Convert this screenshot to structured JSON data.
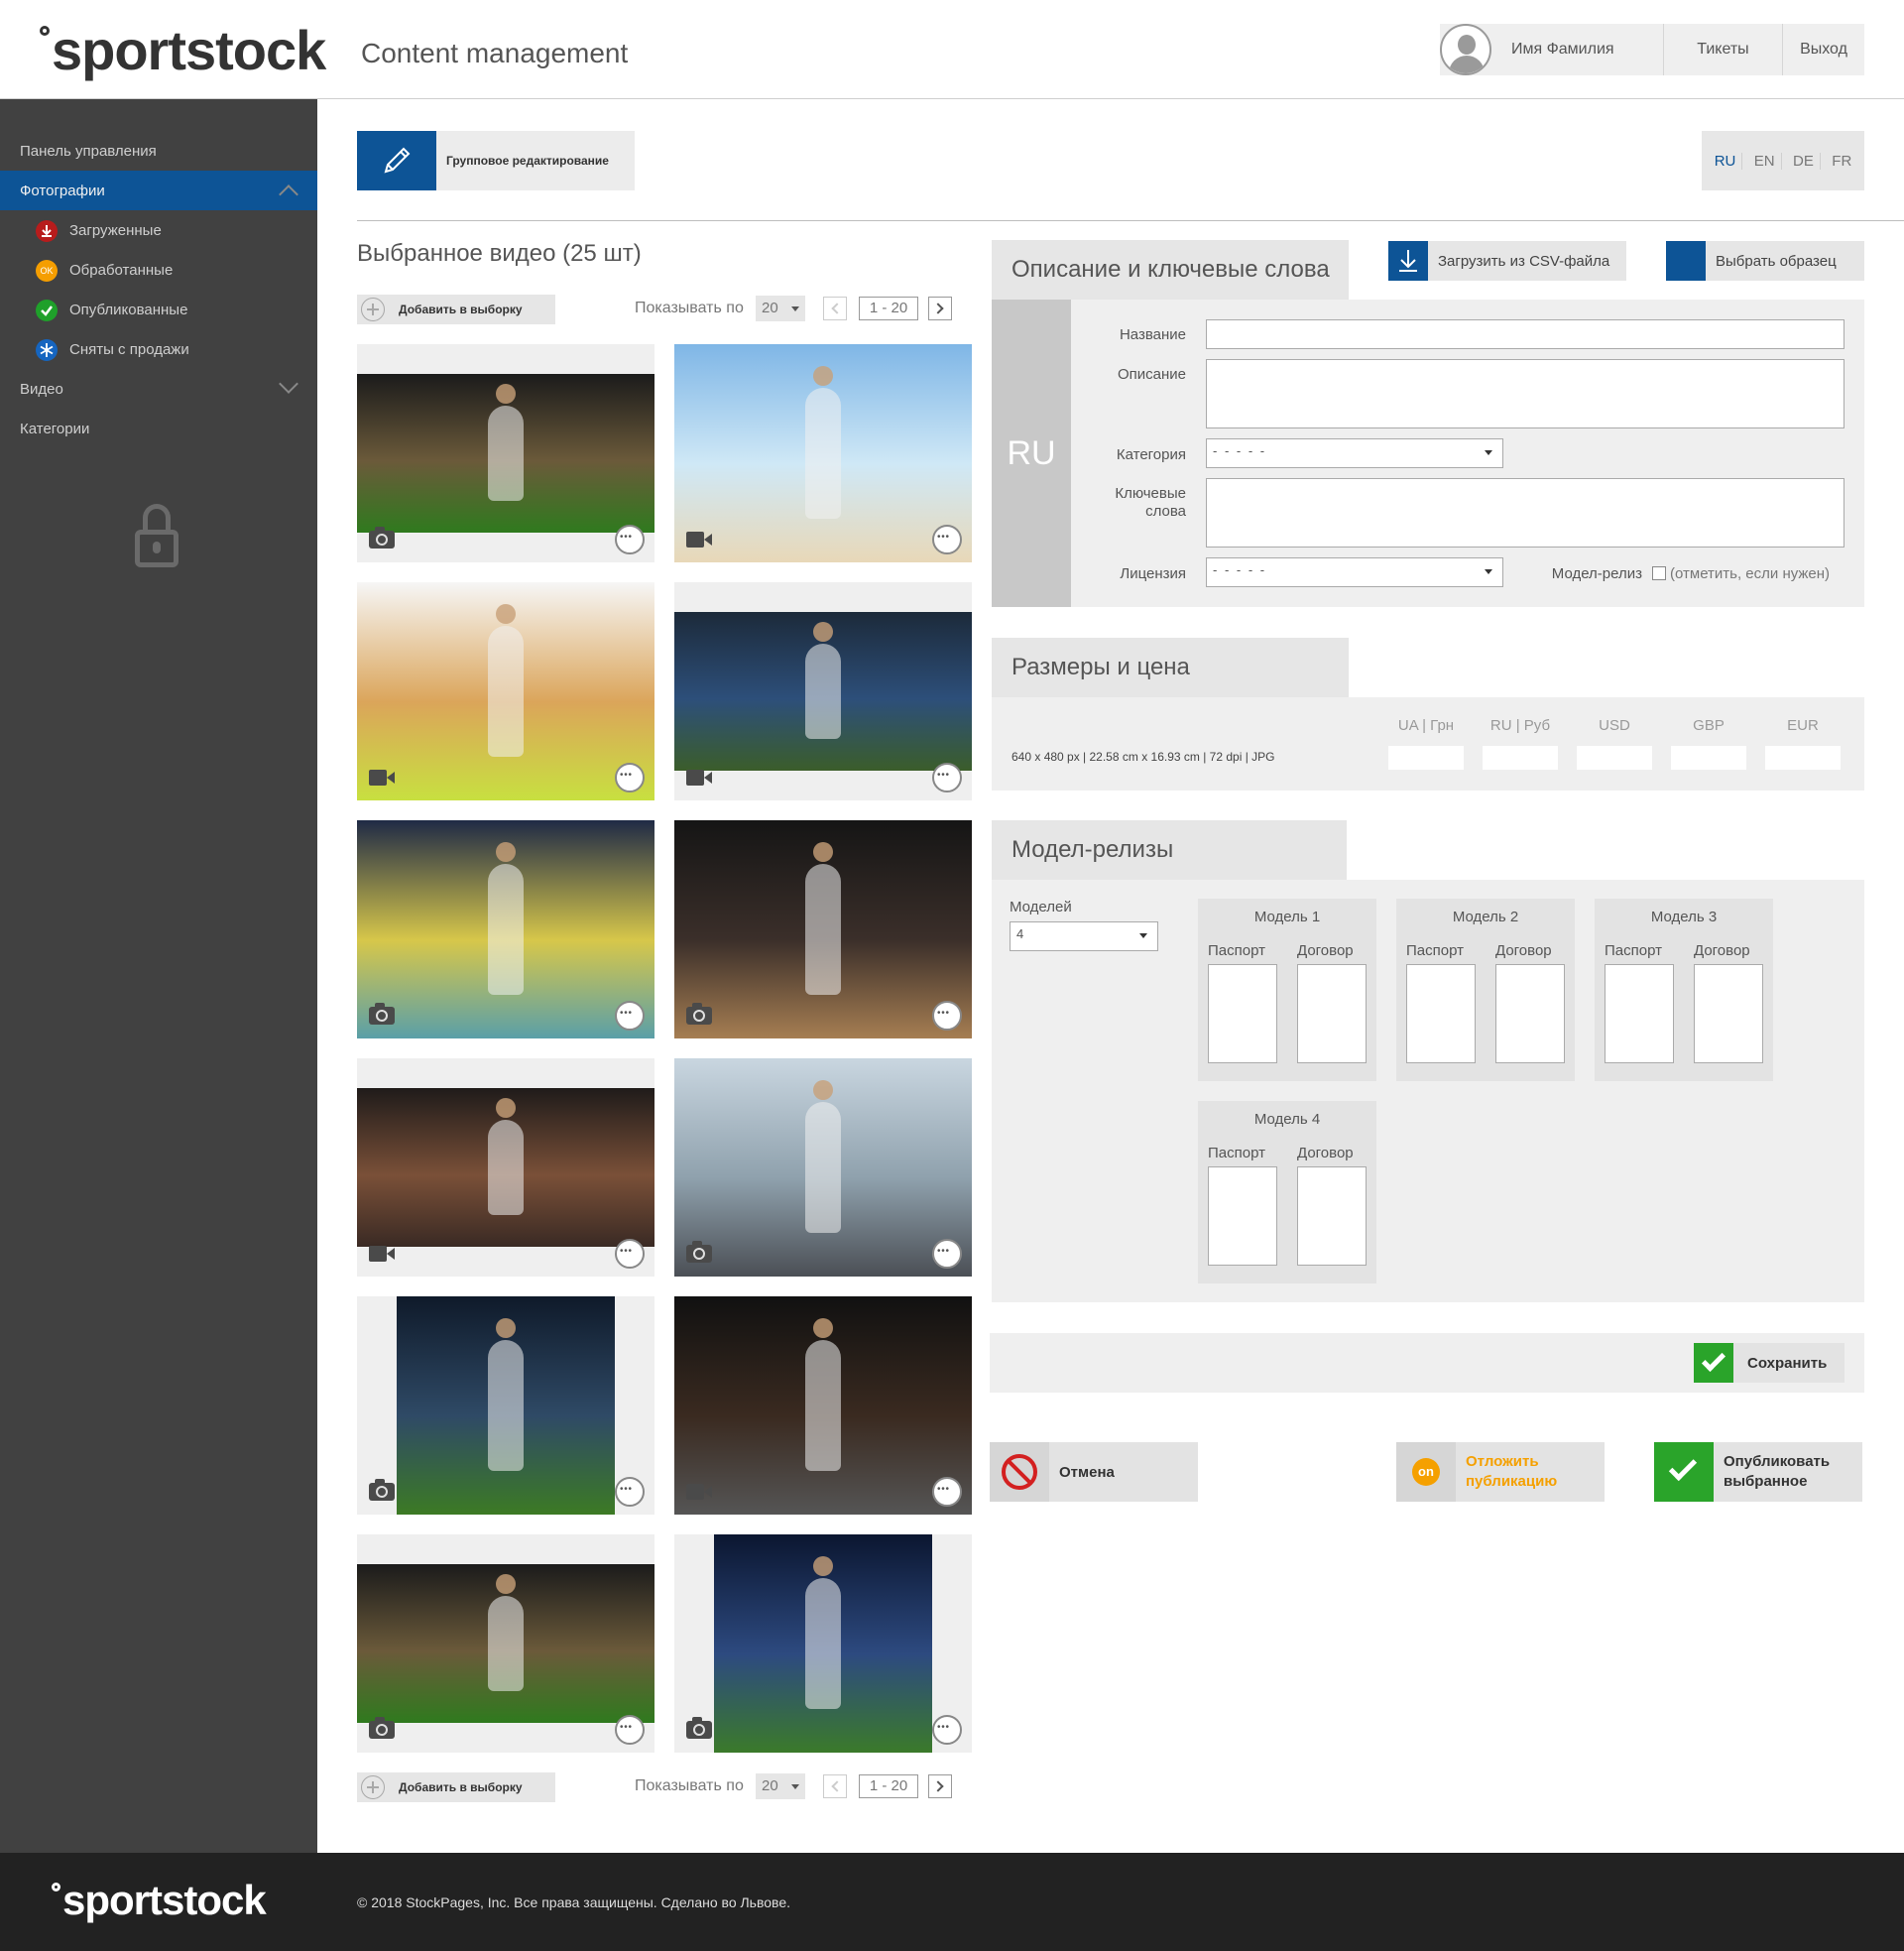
{
  "header": {
    "brand": "sportstock",
    "app_title": "Content management",
    "user_name": "Имя Фамилия",
    "tickets_label": "Тикеты",
    "logout_label": "Выход"
  },
  "sidebar": {
    "dashboard": "Панель управления",
    "photos": "Фотографии",
    "sub_items": [
      {
        "label": "Загруженные",
        "color": "#b71c1c"
      },
      {
        "label": "Обработанные",
        "color": "#f59e00",
        "badge": "OK"
      },
      {
        "label": "Опубликованные",
        "color": "#1fa02a"
      },
      {
        "label": "Сняты с продажи",
        "color": "#1565c0"
      }
    ],
    "video": "Видео",
    "categories": "Категории"
  },
  "toolbar": {
    "group_edit_label": "Групповое редактирование",
    "languages": [
      "RU",
      "EN",
      "DE",
      "FR"
    ],
    "active_language": "RU"
  },
  "selection": {
    "title": "Выбранное видео (25 шт)",
    "add_label": "Добавить в выборку",
    "show_label": "Показывать по",
    "per_page": "20",
    "range": "1 - 20"
  },
  "tiles": [
    {
      "type": "photo",
      "subject": "footballer-goal",
      "colors": [
        "#1b1b1b",
        "#6b5a3a",
        "#2f7a1e"
      ]
    },
    {
      "type": "video",
      "subject": "karate-beach",
      "colors": [
        "#7fb6e6",
        "#cfe8f6",
        "#e8d8b8"
      ]
    },
    {
      "type": "video",
      "subject": "tennis",
      "colors": [
        "#f6f6f6",
        "#dba55a",
        "#c8e040"
      ]
    },
    {
      "type": "video",
      "subject": "soccer-players",
      "colors": [
        "#1c2a3a",
        "#2d4f7a",
        "#3b5d2a"
      ]
    },
    {
      "type": "photo",
      "subject": "volleyball",
      "colors": [
        "#1f2a46",
        "#d7c74a",
        "#5a9fa8"
      ]
    },
    {
      "type": "photo",
      "subject": "basketball",
      "colors": [
        "#151515",
        "#3b2f2a",
        "#a67e52"
      ]
    },
    {
      "type": "video",
      "subject": "womens-basketball",
      "colors": [
        "#1f1b1a",
        "#7a5038",
        "#3a2a24"
      ]
    },
    {
      "type": "photo",
      "subject": "runner-pier",
      "colors": [
        "#c9d6e0",
        "#8fa1ad",
        "#4b4f55"
      ]
    },
    {
      "type": "photo",
      "subject": "soccer-kick",
      "colors": [
        "#0f1a2a",
        "#2f4a66",
        "#3c7a24"
      ]
    },
    {
      "type": "video",
      "subject": "bodybuilder",
      "colors": [
        "#111111",
        "#3a2a20",
        "#555555"
      ]
    },
    {
      "type": "photo",
      "subject": "footballer-goal",
      "colors": [
        "#1b1b1b",
        "#6b5a3a",
        "#2f7a1e"
      ]
    },
    {
      "type": "photo",
      "subject": "goalkeeper-snow",
      "colors": [
        "#0b1630",
        "#2d4a80",
        "#3b7a2a"
      ]
    }
  ],
  "description_panel": {
    "tab_title": "Описание и ключевые слова",
    "csv_label": "Загрузить из CSV-файла",
    "sample_label": "Выбрать образец",
    "lang_badge": "RU",
    "name_label": "Название",
    "desc_label": "Описание",
    "category_label": "Категория",
    "category_value": "- - - - -",
    "keywords_label": "Ключевые слова",
    "license_label": "Лицензия",
    "license_value": "- - - - -",
    "model_release_label": "Модел-релиз",
    "model_release_hint": "(отметить, если нужен)"
  },
  "sizes_panel": {
    "tab_title": "Размеры и цена",
    "info": "640 x 480 px | 22.58 cm x 16.93 cm | 72 dpi | JPG",
    "currencies": [
      "UA  |  Грн",
      "RU  |  Руб",
      "USD",
      "GBP",
      "EUR"
    ]
  },
  "models_panel": {
    "tab_title": "Модел-релизы",
    "count_label": "Моделей",
    "count_value": "4",
    "passport_label": "Паспорт",
    "contract_label": "Договор",
    "models": [
      "Модель 1",
      "Модель 2",
      "Модель 3",
      "Модель 4"
    ]
  },
  "actions": {
    "save": "Сохранить",
    "cancel": "Отмена",
    "postpone": "Отложить публикацию",
    "postpone_badge": "on",
    "publish": "Опубликовать выбранное",
    "colors": {
      "save": "#2aa42a",
      "cancel": "#d32020",
      "postpone": "#f5a000",
      "publish": "#2aa42a"
    }
  },
  "footer": {
    "brand": "sportstock",
    "copyright": "© 2018  StockPages, Inc. Все права защищены. Сделано во Львове."
  }
}
